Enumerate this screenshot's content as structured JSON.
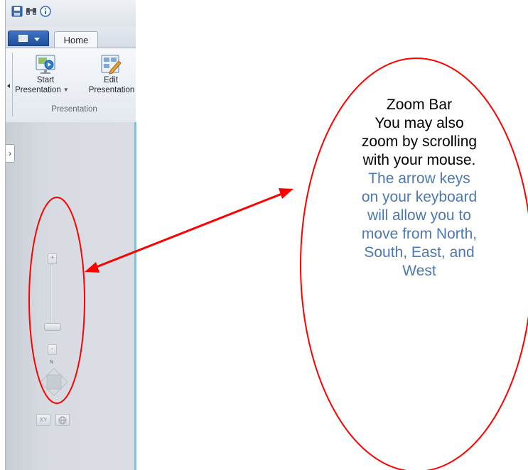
{
  "quick_access": {
    "icons": [
      "save-icon",
      "find-icon",
      "info-icon"
    ]
  },
  "tabs": {
    "home_label": "Home"
  },
  "ribbon": {
    "start_presentation": {
      "line1": "Start",
      "line2": "Presentation",
      "has_dropdown": true
    },
    "edit_presentation": {
      "line1": "Edit",
      "line2": "Presentation"
    },
    "group_label": "Presentation"
  },
  "side_panel": {
    "expand_icon": "chevron-right-icon"
  },
  "zoom_control": {
    "zoom_in_label": "+",
    "zoom_out_label": "-",
    "north_label": "N",
    "xy_label": "XY",
    "globe_icon": "globe-icon"
  },
  "annotation": {
    "title": "Zoom Bar",
    "lines_black": [
      "You may also",
      "zoom by scrolling",
      "with your mouse."
    ],
    "lines_blue": [
      "The arrow keys",
      "on your keyboard",
      "will allow you to",
      "move from North,",
      "South, East, and",
      "West"
    ],
    "colors": {
      "outline": "#ff0000",
      "text": "#000000",
      "highlight": "#4b78b4"
    }
  }
}
